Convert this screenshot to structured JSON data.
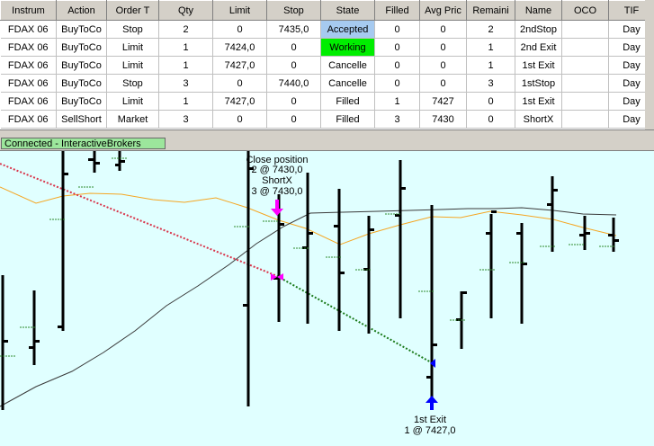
{
  "orders": {
    "columns": [
      "Instrum",
      "Action",
      "Order T",
      "Qty",
      "Limit",
      "Stop",
      "State",
      "Filled",
      "Avg Pric",
      "Remaini",
      "Name",
      "OCO",
      "TIF"
    ],
    "rows": [
      [
        "FDAX 06",
        "BuyToCo",
        "Stop",
        "2",
        "0",
        "7435,0",
        "Accepted",
        "0",
        "0",
        "2",
        "2ndStop",
        "",
        "Day"
      ],
      [
        "FDAX 06",
        "BuyToCo",
        "Limit",
        "1",
        "7424,0",
        "0",
        "Working",
        "0",
        "0",
        "1",
        "2nd Exit",
        "",
        "Day"
      ],
      [
        "FDAX 06",
        "BuyToCo",
        "Limit",
        "1",
        "7427,0",
        "0",
        "Cancelle",
        "0",
        "0",
        "1",
        "1st Exit",
        "",
        "Day"
      ],
      [
        "FDAX 06",
        "BuyToCo",
        "Stop",
        "3",
        "0",
        "7440,0",
        "Cancelle",
        "0",
        "0",
        "3",
        "1stStop",
        "",
        "Day"
      ],
      [
        "FDAX 06",
        "BuyToCo",
        "Limit",
        "1",
        "7427,0",
        "0",
        "Filled",
        "1",
        "7427",
        "0",
        "1st Exit",
        "",
        "Day"
      ],
      [
        "FDAX 06",
        "SellShort",
        "Market",
        "3",
        "0",
        "0",
        "Filled",
        "3",
        "7430",
        "0",
        "ShortX",
        "",
        "Day"
      ]
    ],
    "state_colors": {
      "Accepted": "#a6caf0",
      "Working": "#00ee00"
    }
  },
  "status": {
    "connection": "Connected - InteractiveBrokers"
  },
  "chart": {
    "background": "#e0ffff",
    "bar_color": "#000000",
    "entry_label": [
      "Close position",
      "2 @ 7430,0",
      "ShortX",
      "3 @ 7430,0"
    ],
    "exit_label": [
      "1st Exit",
      "1 @ 7427,0"
    ],
    "colors": {
      "ma_fast": "#f5a623",
      "ma_slow": "#3a3a3a",
      "trade_loss": "#d9344a",
      "trade_win": "#1a7a1a",
      "sell_arrow": "#ff00ff",
      "buy_arrow": "#0000ff",
      "bands": "#2e8b2e"
    }
  }
}
